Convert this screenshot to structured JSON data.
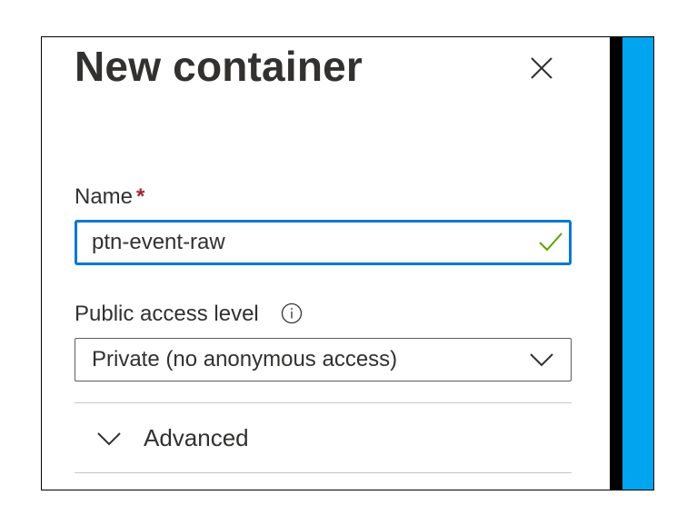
{
  "dialog": {
    "title": "New container"
  },
  "name_field": {
    "label": "Name",
    "required_marker": "*",
    "value": "ptn-event-raw",
    "status_icon": "checkmark-icon",
    "focus_color": "#0078d4",
    "valid_color": "#57a300"
  },
  "access_field": {
    "label": "Public access level",
    "info_icon": "info-icon",
    "selected_value": "Private (no anonymous access)",
    "dropdown_icon": "chevron-down-icon"
  },
  "advanced_section": {
    "label": "Advanced",
    "expand_icon": "chevron-down-icon",
    "expanded": false
  },
  "colors": {
    "accent": "#0078d4",
    "required": "#a4262c",
    "side_panel_blue": "#00a4ef",
    "text": "#323130"
  }
}
